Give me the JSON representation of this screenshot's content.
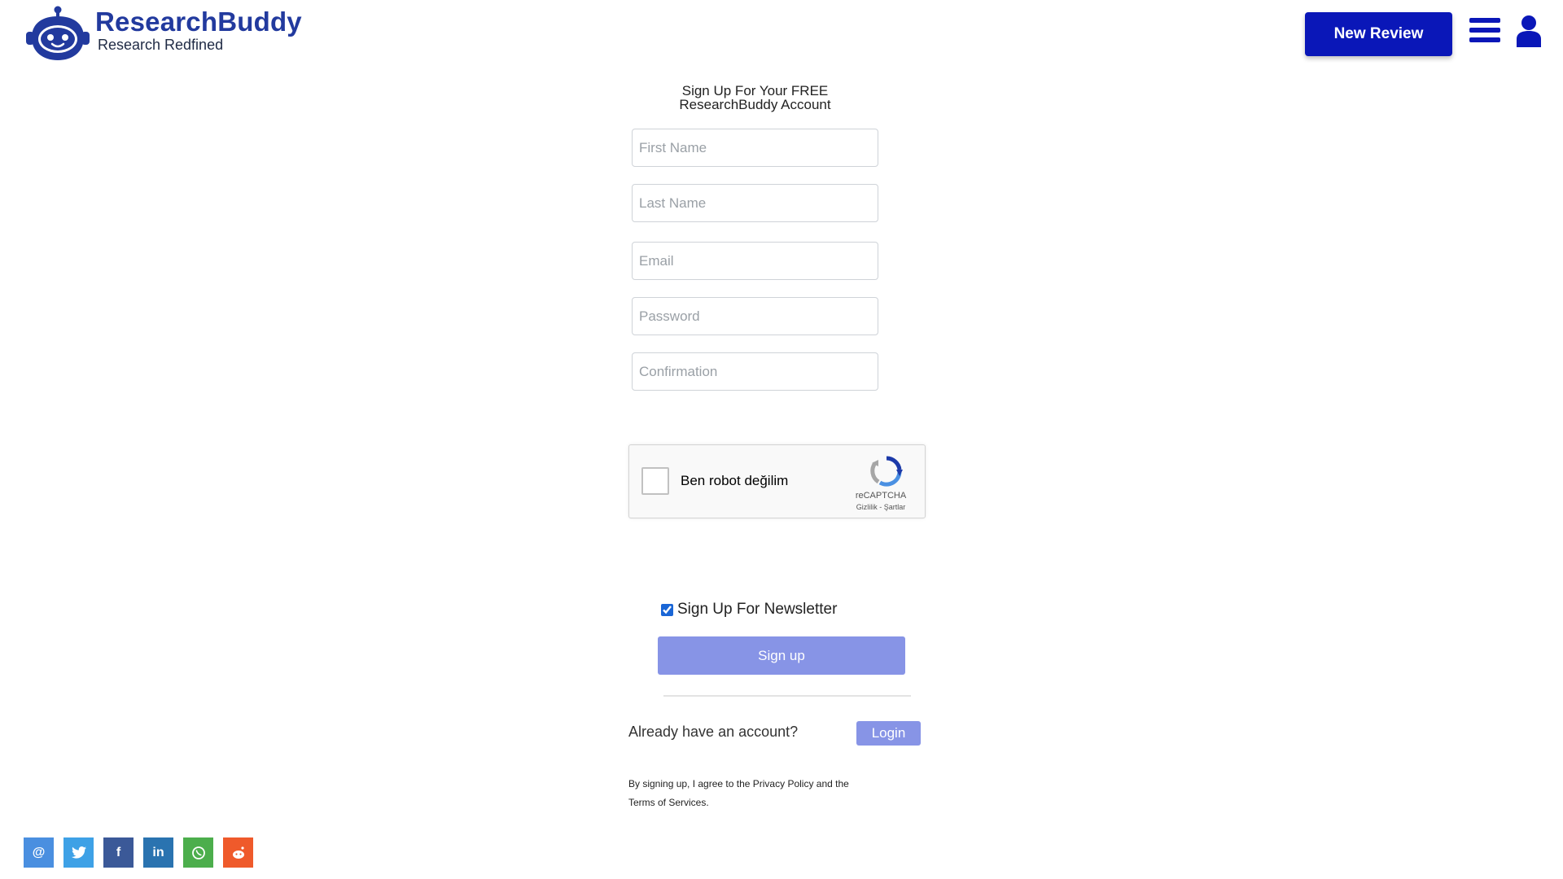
{
  "header": {
    "brand": "ResearchBuddy",
    "tagline": "Research Redfined",
    "new_review_label": "New Review",
    "brand_color": "#223a9e",
    "accent_color": "#0a17b8"
  },
  "form": {
    "title_line1": "Sign Up For Your FREE",
    "title_line2": "ResearchBuddy Account",
    "fields": [
      {
        "placeholder": "First Name",
        "value": ""
      },
      {
        "placeholder": "Last Name",
        "value": ""
      },
      {
        "placeholder": "Email",
        "value": ""
      },
      {
        "placeholder": "Password",
        "value": ""
      },
      {
        "placeholder": "Confirmation",
        "value": ""
      }
    ],
    "captcha": {
      "label": "Ben robot değilim",
      "brand": "reCAPTCHA",
      "links": "Gizlilik - Şartlar"
    },
    "newsletter_label": "Sign Up For Newsletter",
    "newsletter_checked": true,
    "signup_label": "Sign up",
    "already_text": "Already have an account?",
    "login_label": "Login",
    "terms_line1": "By signing up, I agree to the Privacy Policy and the",
    "terms_line2": "Terms of Services."
  },
  "share": [
    {
      "icon": "email-icon",
      "glyph": "@",
      "color": "#4a8fe0"
    },
    {
      "icon": "twitter-icon",
      "glyph": "t",
      "color": "#3ea1e6"
    },
    {
      "icon": "facebook-icon",
      "glyph": "f",
      "color": "#3b5998"
    },
    {
      "icon": "linkedin-icon",
      "glyph": "in",
      "color": "#2a73b0"
    },
    {
      "icon": "whatsapp-icon",
      "glyph": "w",
      "color": "#4cae4c"
    },
    {
      "icon": "reddit-icon",
      "glyph": "r",
      "color": "#ef5a2b"
    }
  ]
}
